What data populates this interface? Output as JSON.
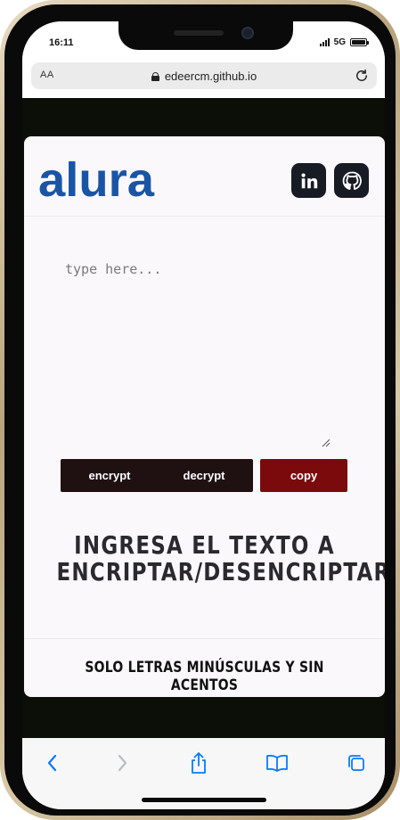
{
  "status_bar": {
    "time": "16:11",
    "network": "5G"
  },
  "browser": {
    "reader_label": "AA",
    "url": "edeercm.github.io"
  },
  "header": {
    "logo_text": "alura",
    "logo_color": "#1a55a5",
    "social": [
      {
        "label": "in",
        "icon": "linkedin-icon"
      },
      {
        "icon": "github-icon"
      }
    ]
  },
  "editor": {
    "placeholder": "type here..."
  },
  "actions": {
    "encrypt_label": "encrypt",
    "decrypt_label": "decrypt",
    "copy_label": "copy"
  },
  "colors": {
    "dark_button": "#1f1112",
    "copy_button": "#7a0a0c",
    "page_background": "#0b0f07",
    "accent_blue": "#0a7aff"
  },
  "main": {
    "headline_line1": "INGRESA EL TEXTO A",
    "headline_line2": "ENCRIPTAR/DESENCRIPTAR"
  },
  "footer": {
    "note": "SOLO LETRAS MINÚSCULAS Y SIN ACENTOS"
  },
  "toolbar": {
    "icons": [
      "back-icon",
      "forward-icon",
      "share-icon",
      "bookmarks-icon",
      "tabs-icon"
    ]
  }
}
